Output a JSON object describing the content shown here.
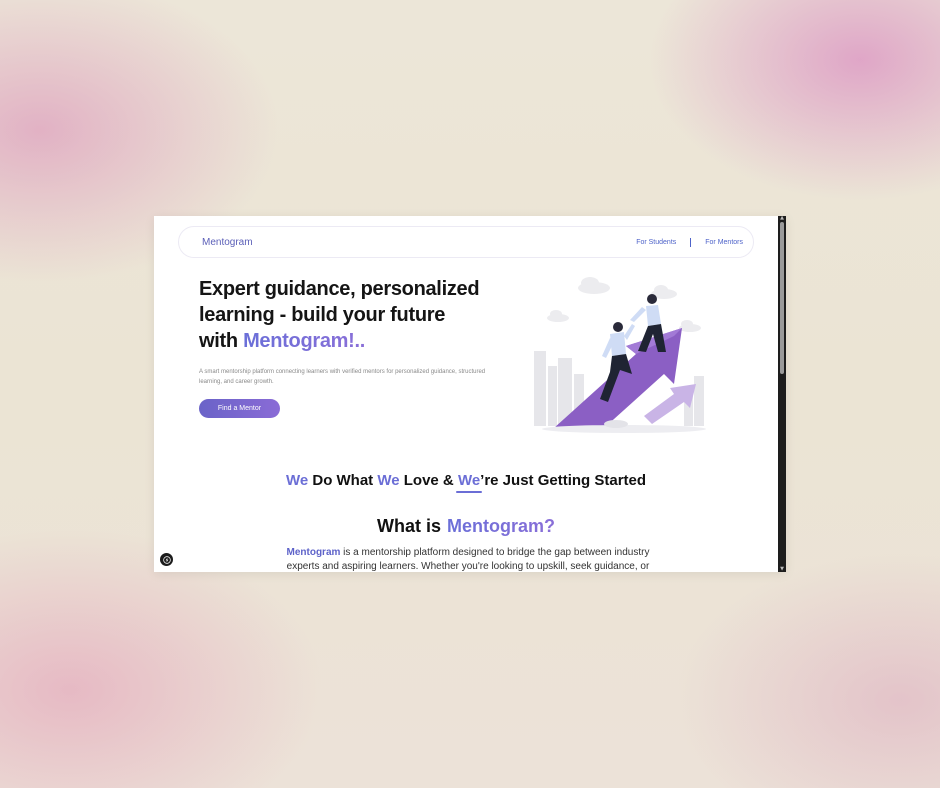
{
  "navbar": {
    "brand": "Mentogram",
    "links": [
      "For Students",
      "For Mentors"
    ]
  },
  "hero": {
    "title_line1": "Expert guidance, personalized",
    "title_line2": "learning - build your future",
    "title_line3_prefix": "with ",
    "title_brand": "Mentogram!..",
    "description": "A smart mentorship platform connecting learners with verified mentors for personalized guidance, structured learning, and career growth.",
    "cta_label": "Find a Mentor",
    "illustration": "mentor-helping-climb-arrow"
  },
  "tagline": {
    "w1": "We",
    "t1": " Do What ",
    "w2": "We",
    "t2": " Love & ",
    "w3": "We",
    "t3": "’re Just Getting Started"
  },
  "about": {
    "heading_prefix": "What is",
    "heading_brand": "Mentogram?",
    "brand_inline": "Mentogram",
    "text": " is a mentorship platform designed to bridge the gap between industry experts and aspiring learners. Whether you're looking to upskill, seek guidance, or gain"
  },
  "colors": {
    "accent": "#6b6ed6",
    "button_start": "#6a63c8",
    "button_end": "#8a6bd6",
    "arrow_purple": "#8b5fc4"
  }
}
